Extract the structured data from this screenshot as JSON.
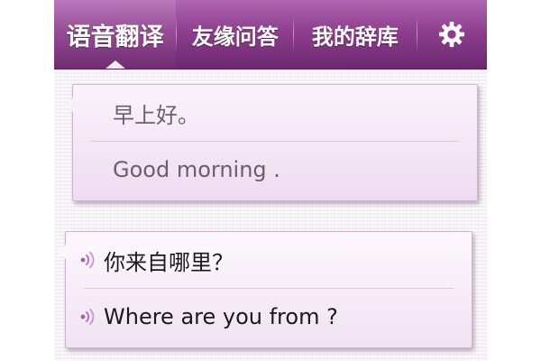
{
  "tabs": [
    {
      "label": "语音翻译",
      "selected": true
    },
    {
      "label": "友缘问答"
    },
    {
      "label": "我的辞库"
    }
  ],
  "settings_icon": "gear-icon",
  "colors": {
    "header_top": "#b066b0",
    "header_bottom": "#6d276f",
    "card_bg": "#efdcf1"
  },
  "conversation": [
    {
      "source": "早上好。",
      "translation": "Good morning .",
      "speaker_icon": false
    },
    {
      "source": "你来自哪里？",
      "translation": "Where are you from ?",
      "speaker_icon": "speaker-icon"
    }
  ]
}
